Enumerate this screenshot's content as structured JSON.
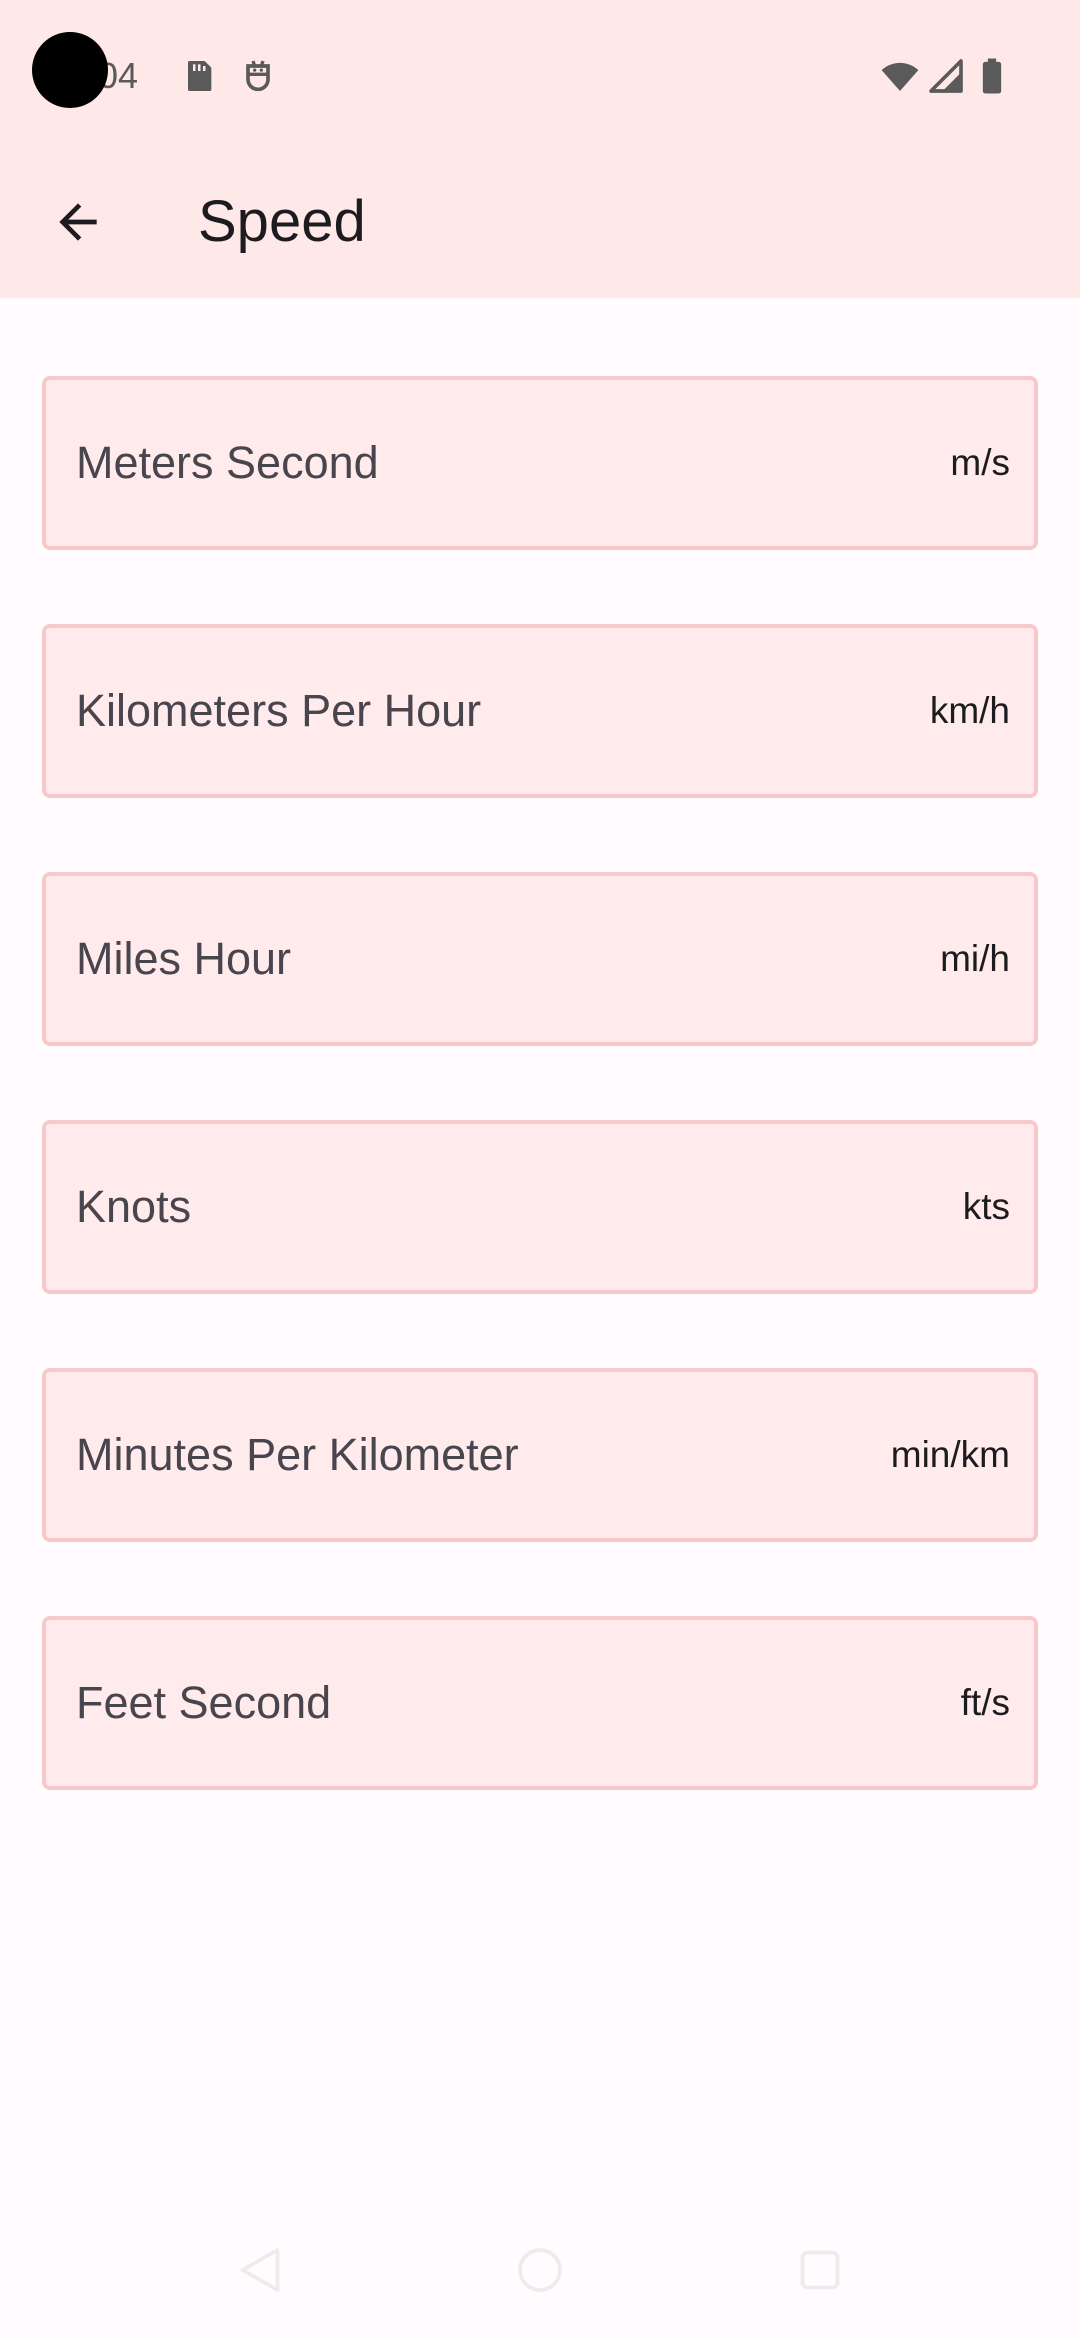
{
  "status_bar": {
    "time": "04",
    "icons": [
      "sd-card-icon",
      "android-debug-icon",
      "wifi-icon",
      "cell-signal-icon",
      "battery-icon"
    ]
  },
  "app_bar": {
    "back_icon": "arrow-left-icon",
    "title": "Speed"
  },
  "units": [
    {
      "name": "Meters Second",
      "abbr": "m/s"
    },
    {
      "name": "Kilometers Per Hour",
      "abbr": "km/h"
    },
    {
      "name": "Miles Hour",
      "abbr": "mi/h"
    },
    {
      "name": "Knots",
      "abbr": "kts"
    },
    {
      "name": "Minutes Per Kilometer",
      "abbr": "min/km"
    },
    {
      "name": "Feet Second",
      "abbr": "ft/s"
    }
  ],
  "nav_bar": {
    "icons": [
      "nav-back-icon",
      "nav-home-icon",
      "nav-recents-icon"
    ]
  },
  "colors": {
    "app_bar_bg": "#ffe8e8",
    "card_bg": "#ffebeb",
    "card_border": "#f7c9c9",
    "page_bg": "#fffbfe"
  }
}
